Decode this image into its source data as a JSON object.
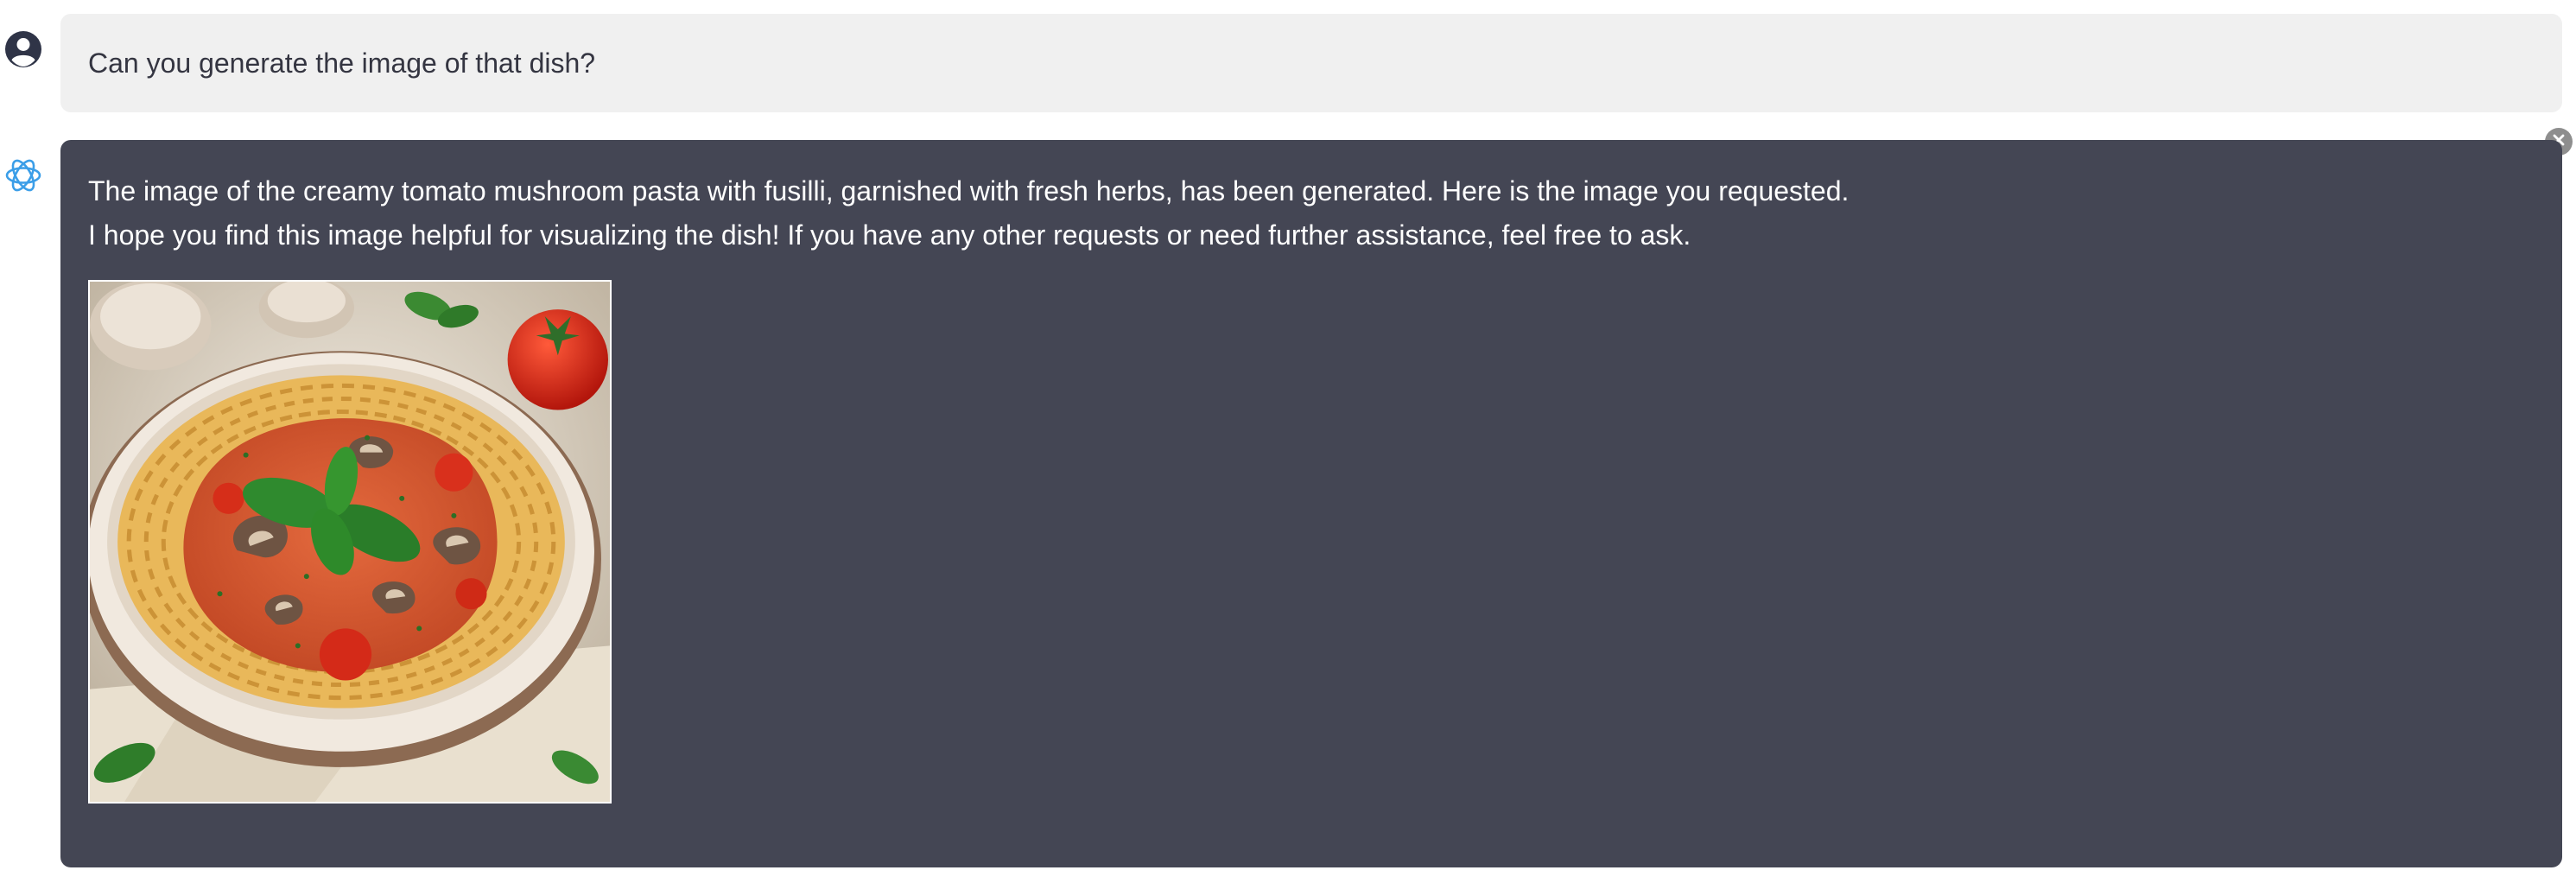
{
  "messages": {
    "user": {
      "avatar_icon": "user-circle-icon",
      "text": "Can you generate the image of that dish?"
    },
    "assistant": {
      "avatar_icon": "openai-logo-icon",
      "line1": "The image of the creamy tomato mushroom pasta with fusilli, garnished with fresh herbs, has been generated. Here is the image you requested.",
      "line2": "I hope you find this image helpful for visualizing the dish! If you have any other requests or need further assistance, feel free to ask.",
      "image_subject": "creamy tomato mushroom pasta with fusilli, garnished with fresh herbs"
    }
  },
  "controls": {
    "close_icon": "close-icon"
  },
  "colors": {
    "user_bubble_bg": "#f0f0f0",
    "assistant_bubble_bg": "#444654",
    "assistant_text": "#ffffff",
    "user_text": "#343541",
    "logo_accent": "#3b9ee8"
  }
}
